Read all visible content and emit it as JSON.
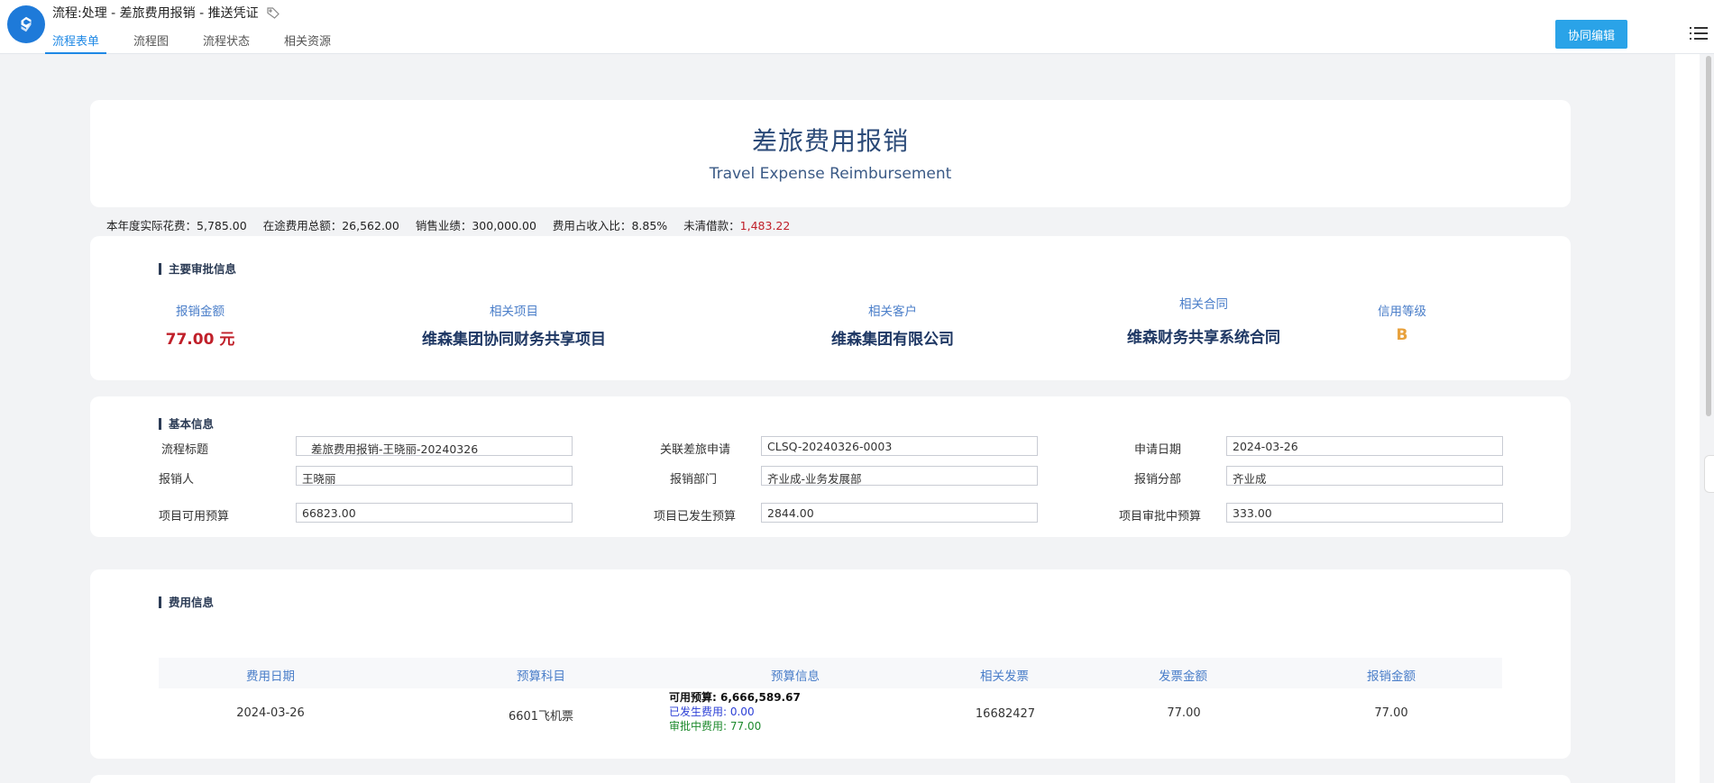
{
  "header": {
    "title": "流程:处理 - 差旅费用报销 - 推送凭证",
    "tabs": [
      {
        "label": "流程表单"
      },
      {
        "label": "流程图"
      },
      {
        "label": "流程状态"
      },
      {
        "label": "相关资源"
      }
    ],
    "collab_button": "协同编辑"
  },
  "form": {
    "title": "差旅费用报销",
    "subtitle": "Travel Expense Reimbursement"
  },
  "stats": [
    {
      "label": "本年度实际花费：",
      "value": "5,785.00"
    },
    {
      "label": "在途费用总额：",
      "value": "26,562.00"
    },
    {
      "label": "销售业绩：",
      "value": "300,000.00"
    },
    {
      "label": "费用占收入比：",
      "value": "8.85%"
    },
    {
      "label": "未清借款：",
      "value": "1,483.22"
    }
  ],
  "approval": {
    "section_title": "主要审批信息",
    "amount": {
      "label": "报销金额",
      "value": "77.00 元"
    },
    "project": {
      "label": "相关项目",
      "value": "维森集团协同财务共享项目"
    },
    "customer": {
      "label": "相关客户",
      "value": "维森集团有限公司"
    },
    "contract": {
      "label": "相关合同",
      "value": "维森财务共享系统合同"
    },
    "credit": {
      "label": "信用等级",
      "value": "B"
    }
  },
  "basic": {
    "section_title": "基本信息",
    "flow_title": {
      "label": "流程标题",
      "value": "差旅费用报销-王晓丽-20240326"
    },
    "related_apply": {
      "label": "关联差旅申请",
      "value": "CLSQ-20240326-0003"
    },
    "apply_date": {
      "label": "申请日期",
      "value": "2024-03-26"
    },
    "applicant": {
      "label": "报销人",
      "value": "王晓丽"
    },
    "department": {
      "label": "报销部门",
      "value": "齐业成-业务发展部"
    },
    "branch": {
      "label": "报销分部",
      "value": "齐业成"
    },
    "available_budget": {
      "label": "项目可用预算",
      "value": "66823.00"
    },
    "used_budget": {
      "label": "项目已发生预算",
      "value": "2844.00"
    },
    "pending_budget": {
      "label": "项目审批中预算",
      "value": "333.00"
    }
  },
  "fee": {
    "section_title": "费用信息",
    "columns": [
      "费用日期",
      "预算科目",
      "预算信息",
      "相关发票",
      "发票金额",
      "报销金额"
    ],
    "rows": [
      {
        "date": "2024-03-26",
        "subject": "6601飞机票",
        "budget_available": "可用预算:  6,666,589.67",
        "budget_used": "已发生费用:  0.00",
        "budget_pending": "审批中费用:  77.00",
        "invoice": "16682427",
        "invoice_amount": "77.00",
        "reimburse_amount": "77.00"
      }
    ]
  }
}
